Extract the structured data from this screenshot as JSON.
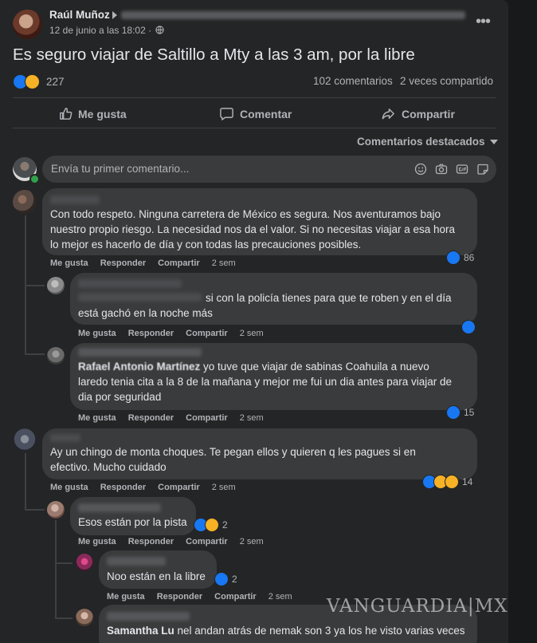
{
  "post": {
    "author": "Raúl Muñoz",
    "date": "12 de junio a las 18:02 ·",
    "text": "Es seguro viajar de Saltillo a Mty a las 3 am, por la libre",
    "reactions_count": "227",
    "comments_count": "102 comentarios",
    "shares_count": "2 veces compartido"
  },
  "actions": {
    "like": "Me gusta",
    "comment": "Comentar",
    "share": "Compartir"
  },
  "sort_label": "Comentarios destacados",
  "composer": {
    "placeholder": "Envía tu primer comentario..."
  },
  "comment_actions": {
    "like": "Me gusta",
    "reply": "Responder",
    "share": "Compartir"
  },
  "comments": [
    {
      "text_lines": [
        "Con todo respeto. Ninguna carretera de México es segura. Nos aventuramos bajo",
        "nuestro propio riesgo. La necesidad nos da el valor. Si no necesitas viajar a esa hora",
        "lo mejor es hacerlo de día y con todas las precauciones posibles."
      ],
      "time": "2 sem",
      "reactions": "86"
    },
    {
      "text_lines": [
        "si con la policía tienes para que te roben y en el día",
        "está gachó en la noche más"
      ],
      "time": "2 sem",
      "reactions": ""
    },
    {
      "name_partial": "Rafael Antonio Martínez",
      "text_lines": [
        "yo tuve que viajar de sabinas Coahuila a nuevo",
        "laredo tenia cita a la 8 de la mañana y mejor me fui un dia antes para viajar de",
        "dia por seguridad"
      ],
      "time": "2 sem",
      "reactions": "15"
    },
    {
      "text_lines": [
        "Ay un chingo de monta choques. Te pegan ellos y quieren q les pagues si en",
        "efectivo. Mucho cuidado"
      ],
      "time": "2 sem",
      "reactions": "14"
    },
    {
      "text_lines": [
        "Esos están por la pista"
      ],
      "time": "2 sem",
      "reactions": "2"
    },
    {
      "text_lines": [
        "Noo están en la libre"
      ],
      "time": "2 sem",
      "reactions": "2"
    },
    {
      "name": "Samantha Lu",
      "text_lines": [
        "nel andan atrás de nemak son 3 ya los he visto varias veces"
      ],
      "time": "",
      "reactions": ""
    }
  ],
  "watermark": "VANGUARDIA|MX",
  "colors": {
    "background": "#18191a",
    "card": "#242526",
    "bubble": "#3a3b3c",
    "accent": "#1877f2",
    "text": "#e4e6eb",
    "muted": "#b0b3b8"
  },
  "icons": [
    "globe-icon",
    "more-icon",
    "like-icon",
    "comment-icon",
    "share-icon",
    "caret-down-icon",
    "emoji-icon",
    "camera-icon",
    "gif-icon",
    "sticker-icon"
  ]
}
